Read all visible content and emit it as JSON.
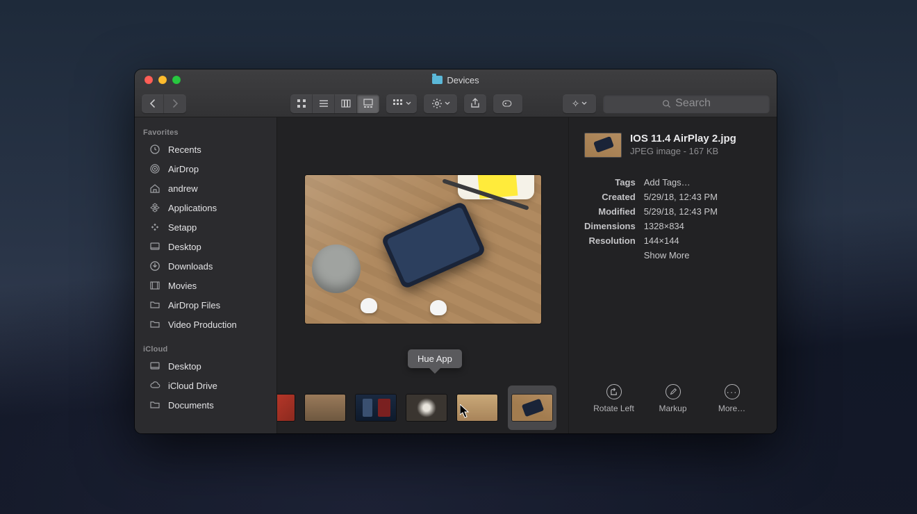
{
  "window": {
    "title": "Devices"
  },
  "toolbar": {
    "searchPlaceholder": "Search"
  },
  "sidebar": {
    "sections": [
      {
        "header": "Favorites",
        "items": [
          {
            "icon": "clock-icon",
            "label": "Recents"
          },
          {
            "icon": "airdrop-icon",
            "label": "AirDrop"
          },
          {
            "icon": "home-icon",
            "label": "andrew"
          },
          {
            "icon": "apps-icon",
            "label": "Applications"
          },
          {
            "icon": "setapp-icon",
            "label": "Setapp"
          },
          {
            "icon": "desktop-icon",
            "label": "Desktop"
          },
          {
            "icon": "downloads-icon",
            "label": "Downloads"
          },
          {
            "icon": "movies-icon",
            "label": "Movies"
          },
          {
            "icon": "folder-icon",
            "label": "AirDrop Files"
          },
          {
            "icon": "folder-icon",
            "label": "Video Production"
          }
        ]
      },
      {
        "header": "iCloud",
        "items": [
          {
            "icon": "desktop-icon",
            "label": "Desktop"
          },
          {
            "icon": "cloud-icon",
            "label": "iCloud Drive"
          },
          {
            "icon": "folder-icon",
            "label": "Documents"
          }
        ]
      }
    ]
  },
  "gallery": {
    "tooltip": "Hue App"
  },
  "info": {
    "filename": "IOS 11.4 AirPlay 2.jpg",
    "type_size": "JPEG image - 167 KB",
    "meta": {
      "tagsLabel": "Tags",
      "tagsValue": "Add Tags…",
      "createdLabel": "Created",
      "createdValue": "5/29/18, 12:43 PM",
      "modifiedLabel": "Modified",
      "modifiedValue": "5/29/18, 12:43 PM",
      "dimensionsLabel": "Dimensions",
      "dimensionsValue": "1328×834",
      "resolutionLabel": "Resolution",
      "resolutionValue": "144×144",
      "showMore": "Show More"
    },
    "quick": {
      "rotate": "Rotate Left",
      "markup": "Markup",
      "more": "More…"
    }
  }
}
